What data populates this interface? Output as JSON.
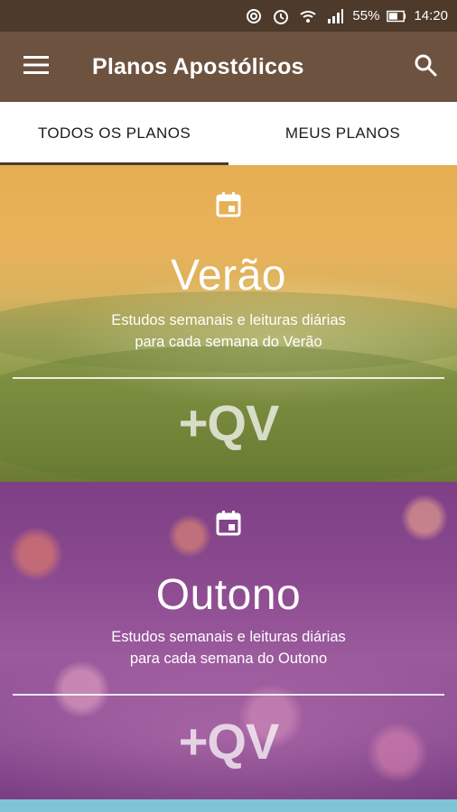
{
  "status_bar": {
    "battery_percent": "55%",
    "time": "14:20",
    "icons": [
      "sync-icon",
      "alarm-icon",
      "wifi-icon",
      "signal-icon",
      "battery-icon"
    ]
  },
  "app_bar": {
    "title": "Planos Apostólicos",
    "background": "#6e5240",
    "menu_icon": "hamburger-menu-icon",
    "search_icon": "search-icon"
  },
  "tabs": [
    {
      "label": "TODOS OS PLANOS",
      "active": true
    },
    {
      "label": "MEUS PLANOS",
      "active": false
    }
  ],
  "plans": [
    {
      "title": "Verão",
      "description_line1": "Estudos semanais e leituras diárias",
      "description_line2": "para cada semana do Verão",
      "logo": "+QV",
      "icon": "calendar-icon",
      "tint": "#e6ae52"
    },
    {
      "title": "Outono",
      "description_line1": "Estudos semanais e leituras diárias",
      "description_line2": "para cada semana do Outono",
      "logo": "+QV",
      "icon": "calendar-icon",
      "tint": "#8b4a8f"
    }
  ]
}
